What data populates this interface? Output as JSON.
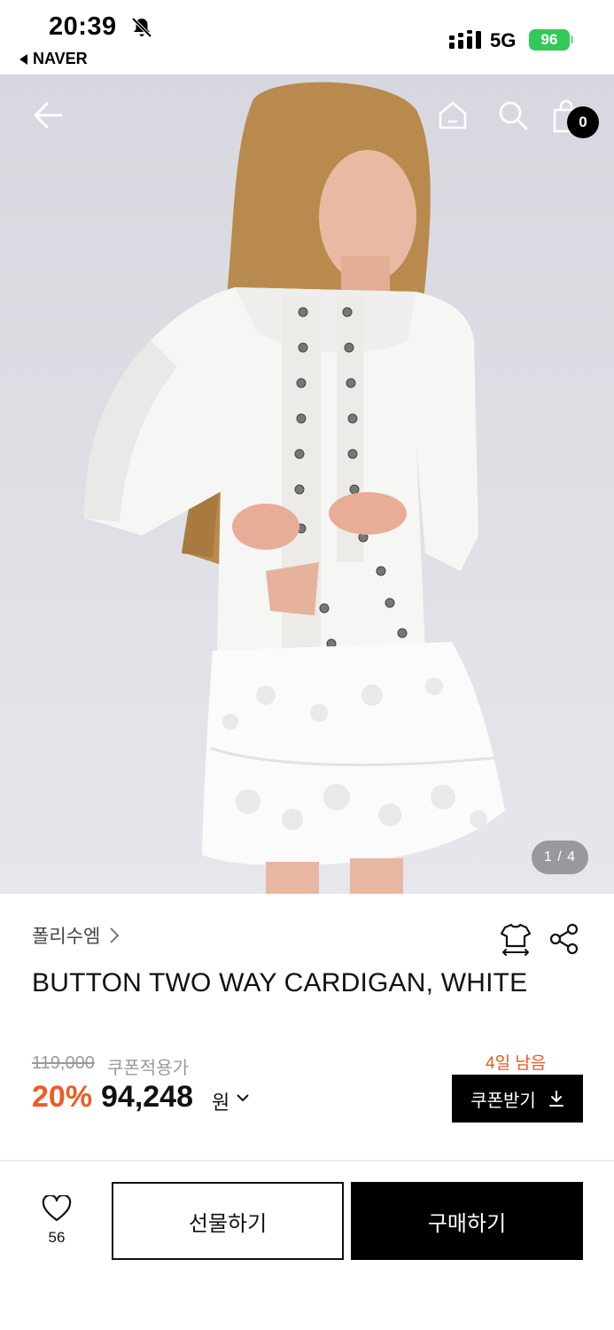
{
  "status_bar": {
    "time": "20:39",
    "back_app": "NAVER",
    "network": "5G",
    "battery": "96"
  },
  "icons": {
    "bell_off": "bell-slash-icon",
    "back": "arrow-left-icon",
    "home": "home-icon",
    "search": "search-icon",
    "cart": "shopping-bag-icon",
    "size": "tshirt-size-icon",
    "share": "share-icon",
    "heart": "heart-icon",
    "download": "download-icon"
  },
  "header": {
    "cart_count": "0"
  },
  "gallery": {
    "pager": "1 / 4"
  },
  "product": {
    "brand": "폴리수엠",
    "title": "BUTTON TWO WAY CARDIGAN, WHITE",
    "original_price": "119,000",
    "coupon_applied_label": "쿠폰적용가",
    "discount": "20%",
    "price": "94,248",
    "currency": "원",
    "days_left": "4일 남음",
    "coupon_button": "쿠폰받기"
  },
  "bottom_bar": {
    "like_count": "56",
    "gift_button": "선물하기",
    "buy_button": "구매하기"
  },
  "colors": {
    "accent_discount": "#f05a23",
    "days_left": "#e85a1c",
    "battery_green": "#34c759",
    "primary_button": "#000000"
  }
}
